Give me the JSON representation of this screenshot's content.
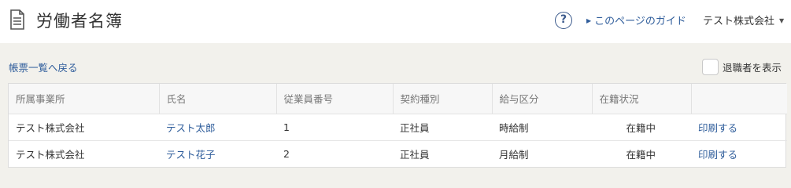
{
  "header": {
    "title": "労働者名簿",
    "icon": "document-icon",
    "help_icon_glyph": "?",
    "guide_link": "このページのガイド",
    "company": "テスト株式会社"
  },
  "toolbar": {
    "back_link": "帳票一覧へ戻る",
    "show_retired_label": "退職者を表示",
    "show_retired_checked": false
  },
  "table": {
    "columns": [
      "所属事業所",
      "氏名",
      "従業員番号",
      "契約種別",
      "給与区分",
      "在籍状況",
      ""
    ],
    "rows": [
      {
        "office": "テスト株式会社",
        "name": "テスト太郎",
        "employee_no": "1",
        "contract": "正社員",
        "pay_type": "時給制",
        "status": "在籍中",
        "action": "印刷する"
      },
      {
        "office": "テスト株式会社",
        "name": "テスト花子",
        "employee_no": "2",
        "contract": "正社員",
        "pay_type": "月給制",
        "status": "在籍中",
        "action": "印刷する"
      }
    ]
  },
  "colors": {
    "link": "#2f5d9b",
    "background": "#f2f1ec",
    "header_bg": "#ffffff"
  }
}
